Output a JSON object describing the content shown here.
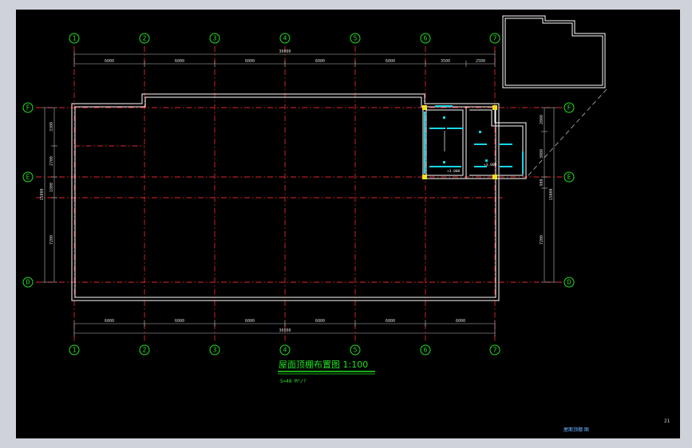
{
  "drawing": {
    "title": "屋面顶棚布置图 1:100",
    "subtitle": "S=48 M²/?",
    "footer_label": "屋面顶棚 图",
    "page_number": "21"
  },
  "axes": {
    "vertical": [
      "1",
      "2",
      "3",
      "4",
      "5",
      "6",
      "7"
    ],
    "horizontal": [
      "F",
      "E",
      "D"
    ]
  },
  "dimensions": {
    "top_spans": [
      "6000",
      "6000",
      "6000",
      "6000",
      "6000",
      "3500",
      "2500"
    ],
    "top_total": "36000",
    "bottom_spans": [
      "6000",
      "6000",
      "6000",
      "6000",
      "6000",
      "6000"
    ],
    "bottom_total": "36000",
    "left_spans": [
      "3300",
      "2700",
      "1800",
      "7200"
    ],
    "left_total": "15000",
    "right_spans": [
      "2000",
      "3000",
      "900",
      "7200"
    ],
    "right_total": "15000"
  },
  "annotations": [
    "+3.000",
    "+3.000"
  ],
  "colors": {
    "background": "#000000",
    "grid": "#e0262a",
    "axis_label": "#22e122",
    "wall": "#ffffff",
    "fixture": "#16d6e6",
    "column": "#f2e020",
    "window_chrome": "#cfd3d9"
  }
}
